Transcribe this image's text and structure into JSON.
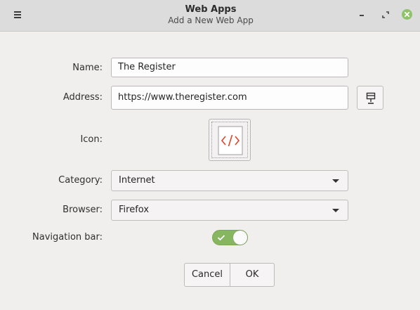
{
  "window": {
    "title": "Web Apps",
    "subtitle": "Add a New Web App",
    "close_color": "#8fc36b"
  },
  "form": {
    "name_label": "Name:",
    "name_value": "The Register",
    "address_label": "Address:",
    "address_value": "https://www.theregister.com",
    "icon_label": "Icon:",
    "category_label": "Category:",
    "category_value": "Internet",
    "browser_label": "Browser:",
    "browser_value": "Firefox",
    "navbar_label": "Navigation bar:",
    "navbar_enabled": true
  },
  "buttons": {
    "cancel": "Cancel",
    "ok": "OK"
  },
  "icons": {
    "menu": "hamburger-menu-icon",
    "minimize": "minimize-icon",
    "restore": "restore-icon",
    "close": "close-icon",
    "favicon_fetch": "download-favicon-icon",
    "webapp": "code-file-icon"
  },
  "colors": {
    "accent_green": "#86b760",
    "webapp_icon": "#e0452a"
  }
}
